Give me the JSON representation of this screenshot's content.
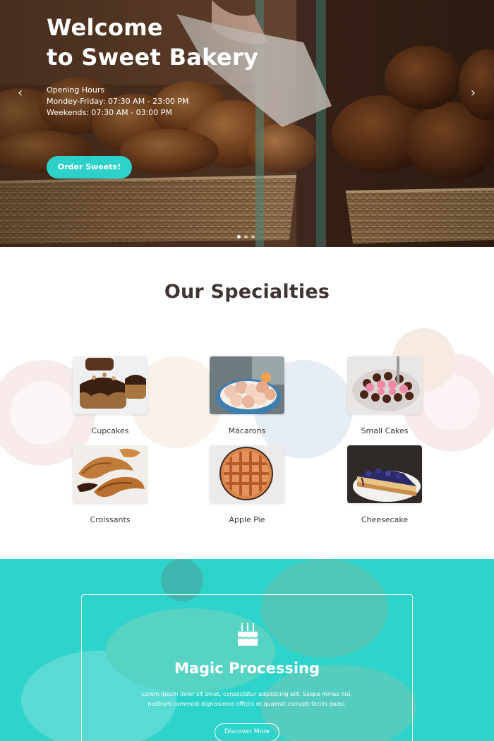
{
  "hero": {
    "title_line1": "Welcome",
    "title_line2": "to Sweet Bakery",
    "hours_label": "Opening Hours",
    "hours_weekdays": "Mondey-Friday: 07:30 AM - 23:00 PM",
    "hours_weekends": "Weekends: 07:30 AM - 03:00 PM",
    "order_button": "Order Sweets!",
    "prev_arrow": "‹",
    "next_arrow": "›",
    "slide_count": 3,
    "active_slide": 1
  },
  "specialties": {
    "title": "Our Specialties",
    "items": [
      {
        "label": "Cupcakes",
        "icon": "cupcakes-image"
      },
      {
        "label": "Macarons",
        "icon": "macarons-image"
      },
      {
        "label": "Small Cakes",
        "icon": "small-cakes-image"
      },
      {
        "label": "Croissants",
        "icon": "croissants-image"
      },
      {
        "label": "Apple Pie",
        "icon": "apple-pie-image"
      },
      {
        "label": "Cheesecake",
        "icon": "cheesecake-image"
      }
    ]
  },
  "magic": {
    "icon": "birthday-cake-icon",
    "title": "Magic Processing",
    "text_line1": "Lorem ipsum dolor sit amet, consectetur adipisicing elit. Saepe minus nisi,",
    "text_line2": "nostrum commodi dignissimos officiis et quaerat corrupti facilis quasi.",
    "button": "Discover More"
  },
  "colors": {
    "accent": "#2dd1c9",
    "heading": "#3f3431",
    "white": "#ffffff"
  }
}
